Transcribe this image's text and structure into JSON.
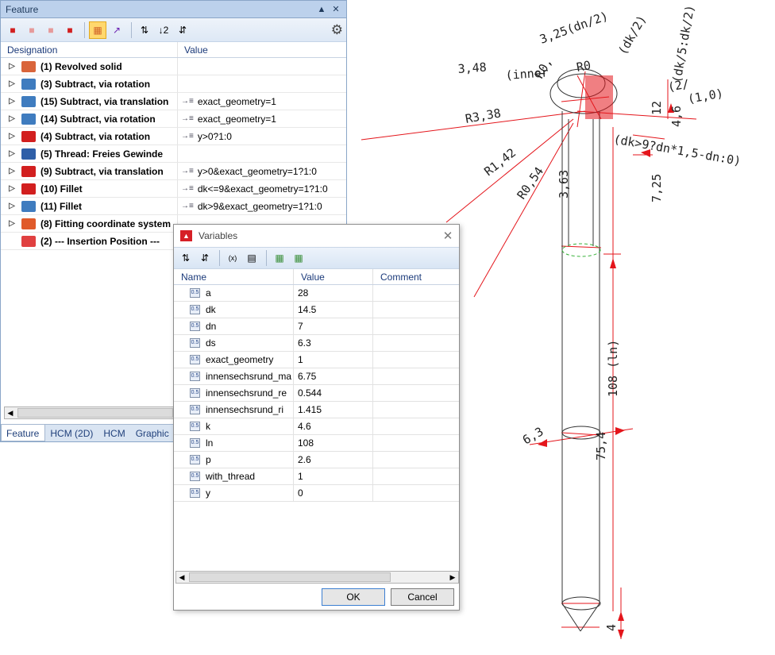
{
  "feature_panel": {
    "title": "Feature",
    "pin_icon": "pin-icon",
    "close_icon": "close-icon",
    "columns": {
      "designation": "Designation",
      "value": "Value"
    },
    "rows": [
      {
        "label": "(1) Revolved solid",
        "value": "",
        "icon_color": "#d9653b"
      },
      {
        "label": "(3) Subtract, via rotation",
        "value": "",
        "icon_color": "#3f7cbf"
      },
      {
        "label": "(15) Subtract, via translation",
        "value": "exact_geometry=1",
        "icon_color": "#3f7cbf"
      },
      {
        "label": "(14) Subtract, via rotation",
        "value": "exact_geometry=1",
        "icon_color": "#3f7cbf"
      },
      {
        "label": "(4) Subtract, via rotation",
        "value": "y>0?1:0",
        "icon_color": "#d21f1f"
      },
      {
        "label": "(5) Thread: Freies Gewinde",
        "value": "",
        "icon_color": "#2f5fa8"
      },
      {
        "label": "(9) Subtract, via translation",
        "value": "y>0&exact_geometry=1?1:0",
        "icon_color": "#d21f1f"
      },
      {
        "label": "(10) Fillet",
        "value": "dk<=9&exact_geometry=1?1:0",
        "icon_color": "#d21f1f"
      },
      {
        "label": "(11) Fillet",
        "value": "dk>9&exact_geometry=1?1:0",
        "icon_color": "#3f7cbf"
      },
      {
        "label": "(8) Fitting coordinate system",
        "value": "",
        "icon_color": "#e05a2a"
      },
      {
        "label": "(2) --- Insertion Position ---",
        "value": "",
        "icon_color": "#e04040"
      }
    ],
    "tabs": [
      "Feature",
      "HCM (2D)",
      "HCM",
      "Graphic",
      "F"
    ]
  },
  "variables_dialog": {
    "title": "Variables",
    "columns": {
      "name": "Name",
      "value": "Value",
      "comment": "Comment"
    },
    "rows": [
      {
        "name": "a",
        "value": "28"
      },
      {
        "name": "dk",
        "value": "14.5"
      },
      {
        "name": "dn",
        "value": "7"
      },
      {
        "name": "ds",
        "value": "6.3"
      },
      {
        "name": "exact_geometry",
        "value": "1"
      },
      {
        "name": "innensechsrund_ma",
        "value": "6.75"
      },
      {
        "name": "innensechsrund_re",
        "value": "0.544"
      },
      {
        "name": "innensechsrund_ri",
        "value": "1.415"
      },
      {
        "name": "k",
        "value": "4.6"
      },
      {
        "name": "ln",
        "value": "108"
      },
      {
        "name": "p",
        "value": "2.6"
      },
      {
        "name": "with_thread",
        "value": "1"
      },
      {
        "name": "y",
        "value": "0"
      }
    ],
    "ok_label": "OK",
    "cancel_label": "Cancel"
  },
  "drawing": {
    "labels": [
      "3,48",
      "(inner",
      "R3,38",
      "R1,42",
      "R0,54",
      "3,63",
      "3,25(dn/2)",
      "R0,",
      "R0",
      "(dk/2)",
      "(dk>9?dn*1,5-dn:0)",
      "7,25",
      "4,6",
      "12",
      "(dk/5:dk/2)",
      "(2/",
      "(1,0)",
      "108 (ln)",
      "6,3",
      "75,4",
      "4"
    ],
    "line_color": "#e4151b",
    "outline_color": "#333333",
    "hidden_color": "#38b23a"
  }
}
